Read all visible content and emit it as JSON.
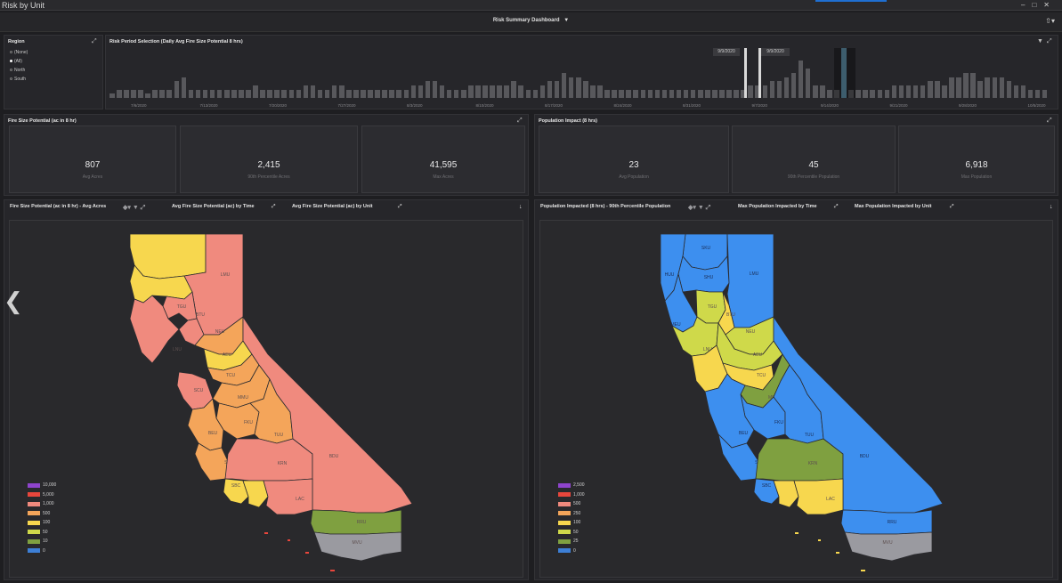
{
  "window": {
    "title": "Risk by Unit"
  },
  "dashboard": {
    "title": "Risk Summary Dashboard"
  },
  "region": {
    "title": "Region",
    "options": [
      {
        "label": "(None)",
        "selected": false
      },
      {
        "label": "(All)",
        "selected": true
      },
      {
        "label": "North",
        "selected": false
      },
      {
        "label": "South",
        "selected": false
      }
    ]
  },
  "period": {
    "title": "Risk Period Selection (Daily Avg Fire Size Potential 8 hrs)",
    "selection_start": "9/9/2020",
    "selection_end": "9/9/2020",
    "x_ticks": [
      "7/6/2020",
      "7/13/2020",
      "7/20/2020",
      "7/27/2020",
      "8/3/2020",
      "8/10/2020",
      "8/17/2020",
      "8/24/2020",
      "8/31/2020",
      "9/7/2020",
      "9/14/2020",
      "9/21/2020",
      "9/28/2020",
      "10/5/2020"
    ]
  },
  "chart_data": {
    "type": "bar",
    "title": "Risk Period Selection (Daily Avg Fire Size Potential 8 hrs)",
    "x_start": "7/1/2020",
    "x_end": "10/10/2020",
    "values": [
      1,
      2,
      2,
      2,
      2,
      1,
      2,
      2,
      2,
      4,
      5,
      2,
      2,
      2,
      2,
      2,
      2,
      2,
      2,
      2,
      3,
      2,
      2,
      2,
      2,
      2,
      2,
      3,
      3,
      2,
      2,
      3,
      3,
      2,
      2,
      2,
      2,
      2,
      2,
      2,
      2,
      2,
      3,
      3,
      4,
      4,
      3,
      2,
      2,
      2,
      3,
      3,
      3,
      3,
      3,
      3,
      4,
      3,
      2,
      2,
      3,
      4,
      4,
      6,
      5,
      5,
      4,
      3,
      3,
      2,
      2,
      2,
      2,
      2,
      2,
      2,
      2,
      2,
      2,
      2,
      2,
      2,
      2,
      2,
      2,
      2,
      2,
      2,
      2,
      3,
      3,
      3,
      4,
      4,
      5,
      6,
      9,
      7,
      3,
      3,
      2,
      2,
      2,
      2,
      2,
      2,
      2,
      2,
      2,
      3,
      3,
      3,
      3,
      3,
      4,
      4,
      3,
      5,
      5,
      6,
      6,
      4,
      5,
      5,
      5,
      4,
      3,
      3,
      2,
      2,
      2
    ],
    "selected_index": 102
  },
  "fire_panel": {
    "title": "Fire Size Potential (ac in 8 hr)",
    "kpis": [
      {
        "value": "807",
        "label": "Avg Acres"
      },
      {
        "value": "2,415",
        "label": "90th Percentile Acres"
      },
      {
        "value": "41,595",
        "label": "Max Acres"
      }
    ]
  },
  "pop_panel": {
    "title": "Population Impact (8 hrs)",
    "kpis": [
      {
        "value": "23",
        "label": "Avg Population"
      },
      {
        "value": "45",
        "label": "90th Percentile Population"
      },
      {
        "value": "6,918",
        "label": "Max Population"
      }
    ]
  },
  "fire_tabs": [
    "Fire Size Potential (ac in 8 hr) - Avg Acres",
    "Avg Fire Size Potential (ac) by Time",
    "Avg Fire Size Potential (ac) by Unit"
  ],
  "pop_tabs": [
    "Population Impacted (8 hrs) - 90th Percentile Population",
    "Max Population Impacted by Time",
    "Max Population Impacted by Unit"
  ],
  "fire_legend": [
    {
      "label": "10,000",
      "color": "#8e44cc"
    },
    {
      "label": "5,000",
      "color": "#e8463c"
    },
    {
      "label": "1,000",
      "color": "#f08a7e"
    },
    {
      "label": "500",
      "color": "#f4a55a"
    },
    {
      "label": "100",
      "color": "#f7d74e"
    },
    {
      "label": "50",
      "color": "#cfd94a"
    },
    {
      "label": "10",
      "color": "#7fa040"
    },
    {
      "label": "0",
      "color": "#3d7fd6"
    }
  ],
  "pop_legend": [
    {
      "label": "2,500",
      "color": "#8e44cc"
    },
    {
      "label": "1,000",
      "color": "#e8463c"
    },
    {
      "label": "500",
      "color": "#f08a7e"
    },
    {
      "label": "250",
      "color": "#f4a55a"
    },
    {
      "label": "100",
      "color": "#f7d74e"
    },
    {
      "label": "50",
      "color": "#cfd94a"
    },
    {
      "label": "25",
      "color": "#7fa040"
    },
    {
      "label": "0",
      "color": "#3d7fd6"
    }
  ],
  "fire_units": [
    {
      "label": "",
      "color": "#f7d74e"
    },
    {
      "label": "",
      "color": "#f7d74e"
    },
    {
      "label": "LMU",
      "color": "#f08a7e"
    },
    {
      "label": "TGU",
      "color": "#f08a7e"
    },
    {
      "label": "BTU",
      "color": "#f08a7e"
    },
    {
      "label": "NEU",
      "color": "#f4a55a"
    },
    {
      "label": "LNU",
      "color": "#f08a7e"
    },
    {
      "label": "AEU",
      "color": "#f7d74e"
    },
    {
      "label": "SCU",
      "color": "#f08a7e"
    },
    {
      "label": "TCU",
      "color": "#f4a55a"
    },
    {
      "label": "MMU",
      "color": "#f4a55a"
    },
    {
      "label": "FKU",
      "color": "#f4a55a"
    },
    {
      "label": "TUU",
      "color": "#f4a55a"
    },
    {
      "label": "BEU",
      "color": "#f4a55a"
    },
    {
      "label": "SLU",
      "color": "#f4a55a"
    },
    {
      "label": "KRN",
      "color": "#f08a7e"
    },
    {
      "label": "BDU",
      "color": "#f08a7e"
    },
    {
      "label": "SBC",
      "color": "#f7d74e"
    },
    {
      "label": "VNC",
      "color": "#f7d74e"
    },
    {
      "label": "LAC",
      "color": "#f08a7e"
    },
    {
      "label": "RRU",
      "color": "#7fa040"
    },
    {
      "label": "MVU",
      "color": "#9a9aa0"
    }
  ],
  "pop_units": [
    {
      "label": "SKU",
      "color": "#3d8fef"
    },
    {
      "label": "HUU",
      "color": "#3d8fef"
    },
    {
      "label": "SHU",
      "color": "#3d8fef"
    },
    {
      "label": "LMU",
      "color": "#3d8fef"
    },
    {
      "label": "TGU",
      "color": "#cfd94a"
    },
    {
      "label": "BTU",
      "color": "#f7d74e"
    },
    {
      "label": "MEU",
      "color": "#3d8fef"
    },
    {
      "label": "NEU",
      "color": "#cfd94a"
    },
    {
      "label": "LNU",
      "color": "#cfd94a"
    },
    {
      "label": "AEU",
      "color": "#cfd94a"
    },
    {
      "label": "SCU",
      "color": "#f7d74e"
    },
    {
      "label": "TCU",
      "color": "#f7d74e"
    },
    {
      "label": "MMU",
      "color": "#7fa040"
    },
    {
      "label": "FKU",
      "color": "#3d8fef"
    },
    {
      "label": "TUU",
      "color": "#3d8fef"
    },
    {
      "label": "BEU",
      "color": "#3d8fef"
    },
    {
      "label": "SLU",
      "color": "#3d8fef"
    },
    {
      "label": "KRN",
      "color": "#7fa040"
    },
    {
      "label": "BDU",
      "color": "#3d8fef"
    },
    {
      "label": "SBC",
      "color": "#3d8fef"
    },
    {
      "label": "VNC",
      "color": "#f7d74e"
    },
    {
      "label": "LAC",
      "color": "#f7d74e"
    },
    {
      "label": "RRU",
      "color": "#3d8fef"
    },
    {
      "label": "MVU",
      "color": "#9a9aa0"
    }
  ]
}
